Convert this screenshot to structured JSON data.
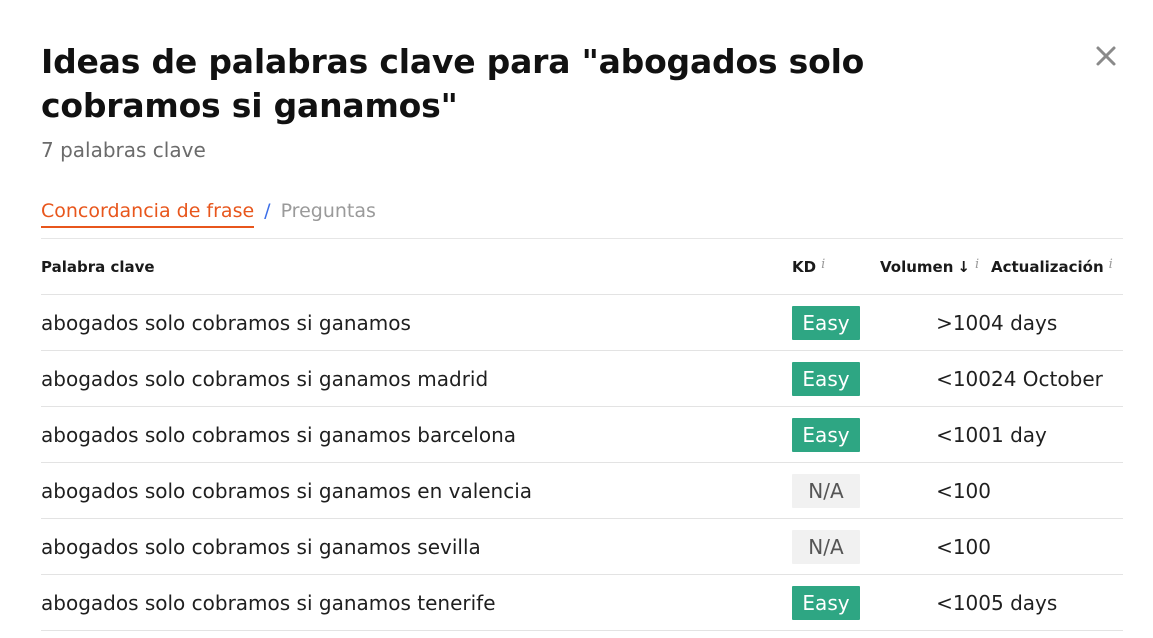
{
  "dialog": {
    "title": "Ideas de palabras clave para \"abogados solo cobramos si ganamos\"",
    "count": "7 palabras clave",
    "close_icon": "close-icon"
  },
  "tabs": {
    "active": "Concordancia de frase",
    "separator": "/",
    "inactive": "Preguntas"
  },
  "table": {
    "headers": {
      "keyword": "Palabra clave",
      "kd": "KD",
      "volume": "Volumen",
      "volume_sort_icon": "↓",
      "updated": "Actualización",
      "info_icon": "i"
    },
    "rows": [
      {
        "keyword": "abogados solo cobramos si ganamos",
        "kd": "Easy",
        "kd_status": "easy",
        "volume": ">100",
        "updated": "4 days"
      },
      {
        "keyword": "abogados solo cobramos si ganamos madrid",
        "kd": "Easy",
        "kd_status": "easy",
        "volume": "<100",
        "updated": "24 October"
      },
      {
        "keyword": "abogados solo cobramos si ganamos barcelona",
        "kd": "Easy",
        "kd_status": "easy",
        "volume": "<100",
        "updated": "1 day"
      },
      {
        "keyword": "abogados solo cobramos si ganamos en valencia",
        "kd": "N/A",
        "kd_status": "na",
        "volume": "<100",
        "updated": ""
      },
      {
        "keyword": "abogados solo cobramos si ganamos sevilla",
        "kd": "N/A",
        "kd_status": "na",
        "volume": "<100",
        "updated": ""
      },
      {
        "keyword": "abogados solo cobramos si ganamos tenerife",
        "kd": "Easy",
        "kd_status": "easy",
        "volume": "<100",
        "updated": "5 days"
      }
    ]
  },
  "colors": {
    "accent_tab": "#e8561c",
    "separator": "#3b6ee8",
    "easy_badge": "#2ea683",
    "na_badge": "#f1f1f1"
  }
}
